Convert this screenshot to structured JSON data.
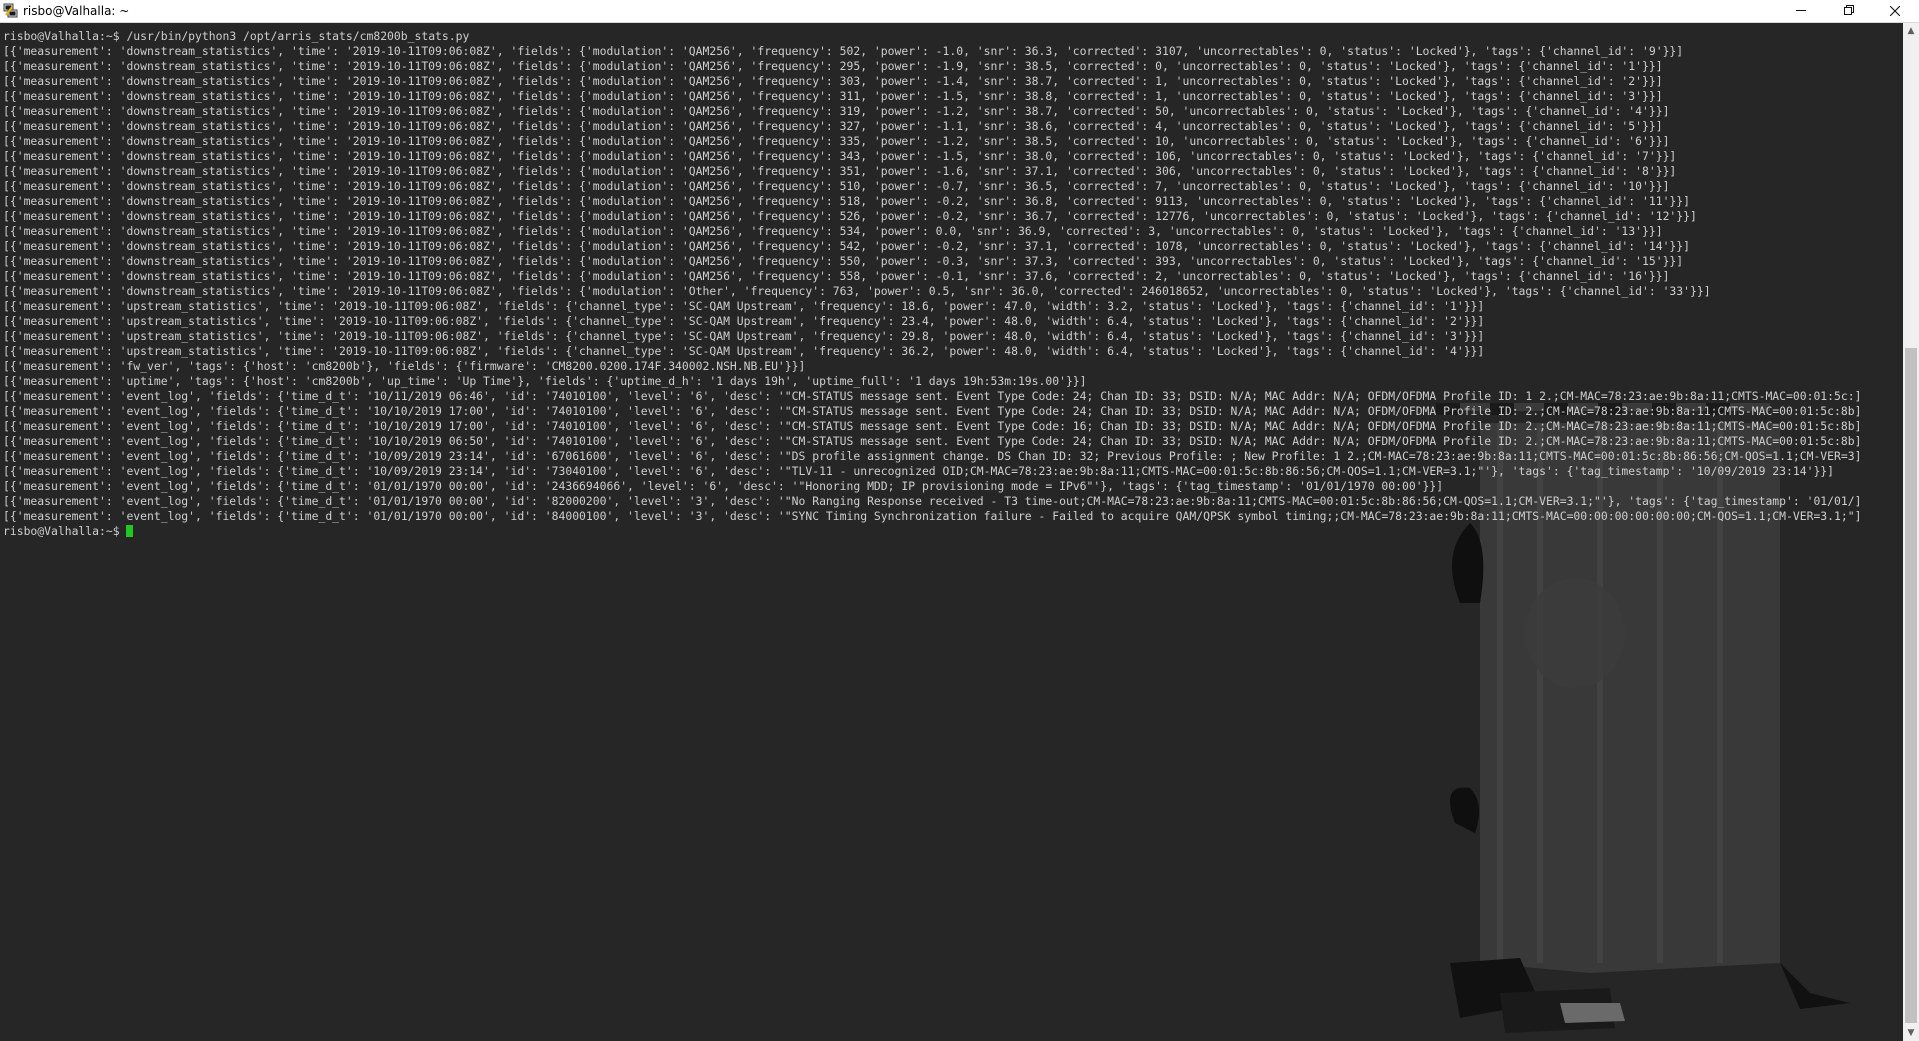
{
  "window": {
    "title": "risbo@Valhalla: ~",
    "minimize_icon": "minimize-icon",
    "maximize_icon": "restore-icon",
    "close_icon": "close-icon"
  },
  "terminal": {
    "prompt": "risbo@Valhalla:~$ ",
    "command": "/usr/bin/python3 /opt/arris_stats/cm8200b_stats.py",
    "cursor_color": "#1fc71f",
    "lines": [
      "[{'measurement': 'downstream_statistics', 'time': '2019-10-11T09:06:08Z', 'fields': {'modulation': 'QAM256', 'frequency': 502, 'power': -1.0, 'snr': 36.3, 'corrected': 3107, 'uncorrectables': 0, 'status': 'Locked'}, 'tags': {'channel_id': '9'}}]",
      "[{'measurement': 'downstream_statistics', 'time': '2019-10-11T09:06:08Z', 'fields': {'modulation': 'QAM256', 'frequency': 295, 'power': -1.9, 'snr': 38.5, 'corrected': 0, 'uncorrectables': 0, 'status': 'Locked'}, 'tags': {'channel_id': '1'}}]",
      "[{'measurement': 'downstream_statistics', 'time': '2019-10-11T09:06:08Z', 'fields': {'modulation': 'QAM256', 'frequency': 303, 'power': -1.4, 'snr': 38.7, 'corrected': 1, 'uncorrectables': 0, 'status': 'Locked'}, 'tags': {'channel_id': '2'}}]",
      "[{'measurement': 'downstream_statistics', 'time': '2019-10-11T09:06:08Z', 'fields': {'modulation': 'QAM256', 'frequency': 311, 'power': -1.5, 'snr': 38.8, 'corrected': 1, 'uncorrectables': 0, 'status': 'Locked'}, 'tags': {'channel_id': '3'}}]",
      "[{'measurement': 'downstream_statistics', 'time': '2019-10-11T09:06:08Z', 'fields': {'modulation': 'QAM256', 'frequency': 319, 'power': -1.2, 'snr': 38.7, 'corrected': 50, 'uncorrectables': 0, 'status': 'Locked'}, 'tags': {'channel_id': '4'}}]",
      "[{'measurement': 'downstream_statistics', 'time': '2019-10-11T09:06:08Z', 'fields': {'modulation': 'QAM256', 'frequency': 327, 'power': -1.1, 'snr': 38.6, 'corrected': 4, 'uncorrectables': 0, 'status': 'Locked'}, 'tags': {'channel_id': '5'}}]",
      "[{'measurement': 'downstream_statistics', 'time': '2019-10-11T09:06:08Z', 'fields': {'modulation': 'QAM256', 'frequency': 335, 'power': -1.2, 'snr': 38.5, 'corrected': 10, 'uncorrectables': 0, 'status': 'Locked'}, 'tags': {'channel_id': '6'}}]",
      "[{'measurement': 'downstream_statistics', 'time': '2019-10-11T09:06:08Z', 'fields': {'modulation': 'QAM256', 'frequency': 343, 'power': -1.5, 'snr': 38.0, 'corrected': 106, 'uncorrectables': 0, 'status': 'Locked'}, 'tags': {'channel_id': '7'}}]",
      "[{'measurement': 'downstream_statistics', 'time': '2019-10-11T09:06:08Z', 'fields': {'modulation': 'QAM256', 'frequency': 351, 'power': -1.6, 'snr': 37.1, 'corrected': 306, 'uncorrectables': 0, 'status': 'Locked'}, 'tags': {'channel_id': '8'}}]",
      "[{'measurement': 'downstream_statistics', 'time': '2019-10-11T09:06:08Z', 'fields': {'modulation': 'QAM256', 'frequency': 510, 'power': -0.7, 'snr': 36.5, 'corrected': 7, 'uncorrectables': 0, 'status': 'Locked'}, 'tags': {'channel_id': '10'}}]",
      "[{'measurement': 'downstream_statistics', 'time': '2019-10-11T09:06:08Z', 'fields': {'modulation': 'QAM256', 'frequency': 518, 'power': -0.2, 'snr': 36.8, 'corrected': 9113, 'uncorrectables': 0, 'status': 'Locked'}, 'tags': {'channel_id': '11'}}]",
      "[{'measurement': 'downstream_statistics', 'time': '2019-10-11T09:06:08Z', 'fields': {'modulation': 'QAM256', 'frequency': 526, 'power': -0.2, 'snr': 36.7, 'corrected': 12776, 'uncorrectables': 0, 'status': 'Locked'}, 'tags': {'channel_id': '12'}}]",
      "[{'measurement': 'downstream_statistics', 'time': '2019-10-11T09:06:08Z', 'fields': {'modulation': 'QAM256', 'frequency': 534, 'power': 0.0, 'snr': 36.9, 'corrected': 3, 'uncorrectables': 0, 'status': 'Locked'}, 'tags': {'channel_id': '13'}}]",
      "[{'measurement': 'downstream_statistics', 'time': '2019-10-11T09:06:08Z', 'fields': {'modulation': 'QAM256', 'frequency': 542, 'power': -0.2, 'snr': 37.1, 'corrected': 1078, 'uncorrectables': 0, 'status': 'Locked'}, 'tags': {'channel_id': '14'}}]",
      "[{'measurement': 'downstream_statistics', 'time': '2019-10-11T09:06:08Z', 'fields': {'modulation': 'QAM256', 'frequency': 550, 'power': -0.3, 'snr': 37.3, 'corrected': 393, 'uncorrectables': 0, 'status': 'Locked'}, 'tags': {'channel_id': '15'}}]",
      "[{'measurement': 'downstream_statistics', 'time': '2019-10-11T09:06:08Z', 'fields': {'modulation': 'QAM256', 'frequency': 558, 'power': -0.1, 'snr': 37.6, 'corrected': 2, 'uncorrectables': 0, 'status': 'Locked'}, 'tags': {'channel_id': '16'}}]",
      "[{'measurement': 'downstream_statistics', 'time': '2019-10-11T09:06:08Z', 'fields': {'modulation': 'Other', 'frequency': 763, 'power': 0.5, 'snr': 36.0, 'corrected': 246018652, 'uncorrectables': 0, 'status': 'Locked'}, 'tags': {'channel_id': '33'}}]",
      "[{'measurement': 'upstream_statistics', 'time': '2019-10-11T09:06:08Z', 'fields': {'channel_type': 'SC-QAM Upstream', 'frequency': 18.6, 'power': 47.0, 'width': 3.2, 'status': 'Locked'}, 'tags': {'channel_id': '1'}}]",
      "[{'measurement': 'upstream_statistics', 'time': '2019-10-11T09:06:08Z', 'fields': {'channel_type': 'SC-QAM Upstream', 'frequency': 23.4, 'power': 48.0, 'width': 6.4, 'status': 'Locked'}, 'tags': {'channel_id': '2'}}]",
      "[{'measurement': 'upstream_statistics', 'time': '2019-10-11T09:06:08Z', 'fields': {'channel_type': 'SC-QAM Upstream', 'frequency': 29.8, 'power': 48.0, 'width': 6.4, 'status': 'Locked'}, 'tags': {'channel_id': '3'}}]",
      "[{'measurement': 'upstream_statistics', 'time': '2019-10-11T09:06:08Z', 'fields': {'channel_type': 'SC-QAM Upstream', 'frequency': 36.2, 'power': 48.0, 'width': 6.4, 'status': 'Locked'}, 'tags': {'channel_id': '4'}}]",
      "[{'measurement': 'fw_ver', 'tags': {'host': 'cm8200b'}, 'fields': {'firmware': 'CM8200.0200.174F.340002.NSH.NB.EU'}}]",
      "[{'measurement': 'uptime', 'tags': {'host': 'cm8200b', 'up_time': 'Up Time'}, 'fields': {'uptime_d_h': '1 days 19h', 'uptime_full': '1 days 19h:53m:19s.00'}}]",
      "[{'measurement': 'event_log', 'fields': {'time_d_t': '10/11/2019 06:46', 'id': '74010100', 'level': '6', 'desc': '\"CM-STATUS message sent. Event Type Code: 24; Chan ID: 33; DSID: N/A; MAC Addr: N/A; OFDM/OFDMA Profile ID: 1 2.;CM-MAC=78:23:ae:9b:8a:11;CMTS-MAC=00:01:5c:]",
      "[{'measurement': 'event_log', 'fields': {'time_d_t': '10/10/2019 17:00', 'id': '74010100', 'level': '6', 'desc': '\"CM-STATUS message sent. Event Type Code: 24; Chan ID: 33; DSID: N/A; MAC Addr: N/A; OFDM/OFDMA Profile ID: 2.;CM-MAC=78:23:ae:9b:8a:11;CMTS-MAC=00:01:5c:8b]",
      "[{'measurement': 'event_log', 'fields': {'time_d_t': '10/10/2019 17:00', 'id': '74010100', 'level': '6', 'desc': '\"CM-STATUS message sent. Event Type Code: 16; Chan ID: 33; DSID: N/A; MAC Addr: N/A; OFDM/OFDMA Profile ID: 2.;CM-MAC=78:23:ae:9b:8a:11;CMTS-MAC=00:01:5c:8b]",
      "[{'measurement': 'event_log', 'fields': {'time_d_t': '10/10/2019 06:50', 'id': '74010100', 'level': '6', 'desc': '\"CM-STATUS message sent. Event Type Code: 24; Chan ID: 33; DSID: N/A; MAC Addr: N/A; OFDM/OFDMA Profile ID: 2.;CM-MAC=78:23:ae:9b:8a:11;CMTS-MAC=00:01:5c:8b]",
      "[{'measurement': 'event_log', 'fields': {'time_d_t': '10/09/2019 23:14', 'id': '67061600', 'level': '6', 'desc': '\"DS profile assignment change. DS Chan ID: 32; Previous Profile: ; New Profile: 1 2.;CM-MAC=78:23:ae:9b:8a:11;CMTS-MAC=00:01:5c:8b:86:56;CM-QOS=1.1;CM-VER=3]",
      "[{'measurement': 'event_log', 'fields': {'time_d_t': '10/09/2019 23:14', 'id': '73040100', 'level': '6', 'desc': '\"TLV-11 - unrecognized OID;CM-MAC=78:23:ae:9b:8a:11;CMTS-MAC=00:01:5c:8b:86:56;CM-QOS=1.1;CM-VER=3.1;\"'}, 'tags': {'tag_timestamp': '10/09/2019 23:14'}}]",
      "[{'measurement': 'event_log', 'fields': {'time_d_t': '01/01/1970 00:00', 'id': '2436694066', 'level': '6', 'desc': '\"Honoring MDD; IP provisioning mode = IPv6\"'}, 'tags': {'tag_timestamp': '01/01/1970 00:00'}}]",
      "[{'measurement': 'event_log', 'fields': {'time_d_t': '01/01/1970 00:00', 'id': '82000200', 'level': '3', 'desc': '\"No Ranging Response received - T3 time-out;CM-MAC=78:23:ae:9b:8a:11;CMTS-MAC=00:01:5c:8b:86:56;CM-QOS=1.1;CM-VER=3.1;\"'}, 'tags': {'tag_timestamp': '01/01/]",
      "[{'measurement': 'event_log', 'fields': {'time_d_t': '01/01/1970 00:00', 'id': '84000100', 'level': '3', 'desc': '\"SYNC Timing Synchronization failure - Failed to acquire QAM/QPSK symbol timing;;CM-MAC=78:23:ae:9b:8a:11;CMTS-MAC=00:00:00:00:00:00;CM-QOS=1.1;CM-VER=3.1;\"]"
    ]
  },
  "colors": {
    "background": "#262626",
    "text": "#cfcfcf",
    "titlebar": "#ffffff",
    "scrollbar_track": "#f0f0f0",
    "scrollbar_thumb": "#c1c1c1"
  }
}
